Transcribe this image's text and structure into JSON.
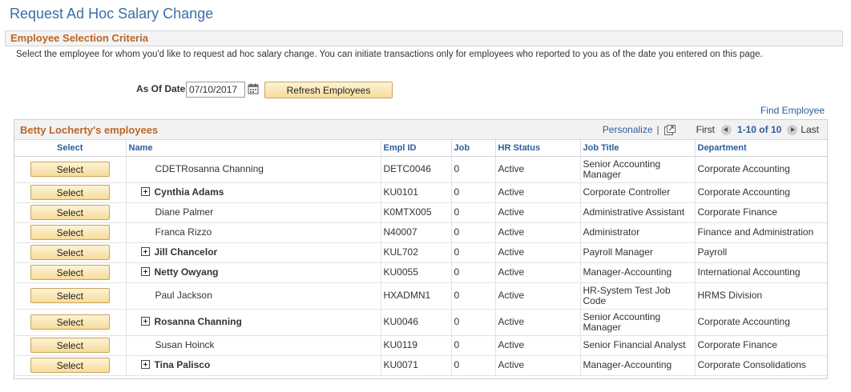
{
  "page": {
    "title": "Request Ad Hoc Salary Change"
  },
  "section": {
    "title": "Employee Selection Criteria",
    "instructions": "Select the employee for whom you'd like to request ad hoc salary change. You can initiate transactions only for employees who reported to you as of the date you entered on this page."
  },
  "form": {
    "as_of_label": "As Of Date",
    "as_of_value": "07/10/2017",
    "refresh_label": "Refresh Employees",
    "find_employee": "Find Employee"
  },
  "grid": {
    "title": "Betty Locherty's employees",
    "personalize": "Personalize",
    "first": "First",
    "range": "1-10 of 10",
    "last": "Last",
    "columns": [
      "Select",
      "Name",
      "Empl ID",
      "Job",
      "HR Status",
      "Job Title",
      "Department"
    ],
    "select_label": "Select",
    "rows": [
      {
        "name": "CDETRosanna Channing",
        "expandable": false,
        "empl_id": "DETC0046",
        "job": "0",
        "status": "Active",
        "title": "Senior Accounting Manager",
        "dept": "Corporate Accounting",
        "tall": true
      },
      {
        "name": "Cynthia Adams",
        "expandable": true,
        "empl_id": "KU0101",
        "job": "0",
        "status": "Active",
        "title": "Corporate Controller",
        "dept": "Corporate Accounting",
        "tall": false
      },
      {
        "name": "Diane Palmer",
        "expandable": false,
        "empl_id": "K0MTX005",
        "job": "0",
        "status": "Active",
        "title": "Administrative Assistant",
        "dept": "Corporate Finance",
        "tall": false
      },
      {
        "name": "Franca Rizzo",
        "expandable": false,
        "empl_id": "N40007",
        "job": "0",
        "status": "Active",
        "title": "Administrator",
        "dept": "Finance and Administration",
        "tall": false
      },
      {
        "name": "Jill Chancelor",
        "expandable": true,
        "empl_id": "KUL702",
        "job": "0",
        "status": "Active",
        "title": "Payroll Manager",
        "dept": "Payroll",
        "tall": false
      },
      {
        "name": "Netty Owyang",
        "expandable": true,
        "empl_id": "KU0055",
        "job": "0",
        "status": "Active",
        "title": "Manager-Accounting",
        "dept": "International Accounting",
        "tall": false
      },
      {
        "name": "Paul Jackson",
        "expandable": false,
        "empl_id": "HXADMN1",
        "job": "0",
        "status": "Active",
        "title": "HR-System Test Job Code",
        "dept": "HRMS Division",
        "tall": true
      },
      {
        "name": "Rosanna Channing",
        "expandable": true,
        "empl_id": "KU0046",
        "job": "0",
        "status": "Active",
        "title": "Senior Accounting Manager",
        "dept": "Corporate Accounting",
        "tall": true
      },
      {
        "name": "Susan Hoinck",
        "expandable": false,
        "empl_id": "KU0119",
        "job": "0",
        "status": "Active",
        "title": "Senior Financial Analyst",
        "dept": "Corporate Finance",
        "tall": false
      },
      {
        "name": "Tina Palisco",
        "expandable": true,
        "empl_id": "KU0071",
        "job": "0",
        "status": "Active",
        "title": "Manager-Accounting",
        "dept": "Corporate Consolidations",
        "tall": false
      }
    ]
  }
}
